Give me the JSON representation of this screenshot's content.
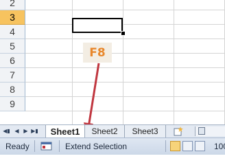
{
  "grid": {
    "rows": [
      "2",
      "3",
      "4",
      "5",
      "6",
      "7",
      "8",
      "9"
    ],
    "selected_row": "3"
  },
  "annotation": {
    "key_label": "F8"
  },
  "sheet_tabs": {
    "tabs": [
      "Sheet1",
      "Sheet2",
      "Sheet3"
    ],
    "active": "Sheet1"
  },
  "status_bar": {
    "ready": "Ready",
    "mode": "Extend Selection",
    "zoom": "100"
  },
  "colors": {
    "selected_row_header": "#f7c35f",
    "annotation_text": "#e8872c",
    "arrow": "#c0363f"
  }
}
